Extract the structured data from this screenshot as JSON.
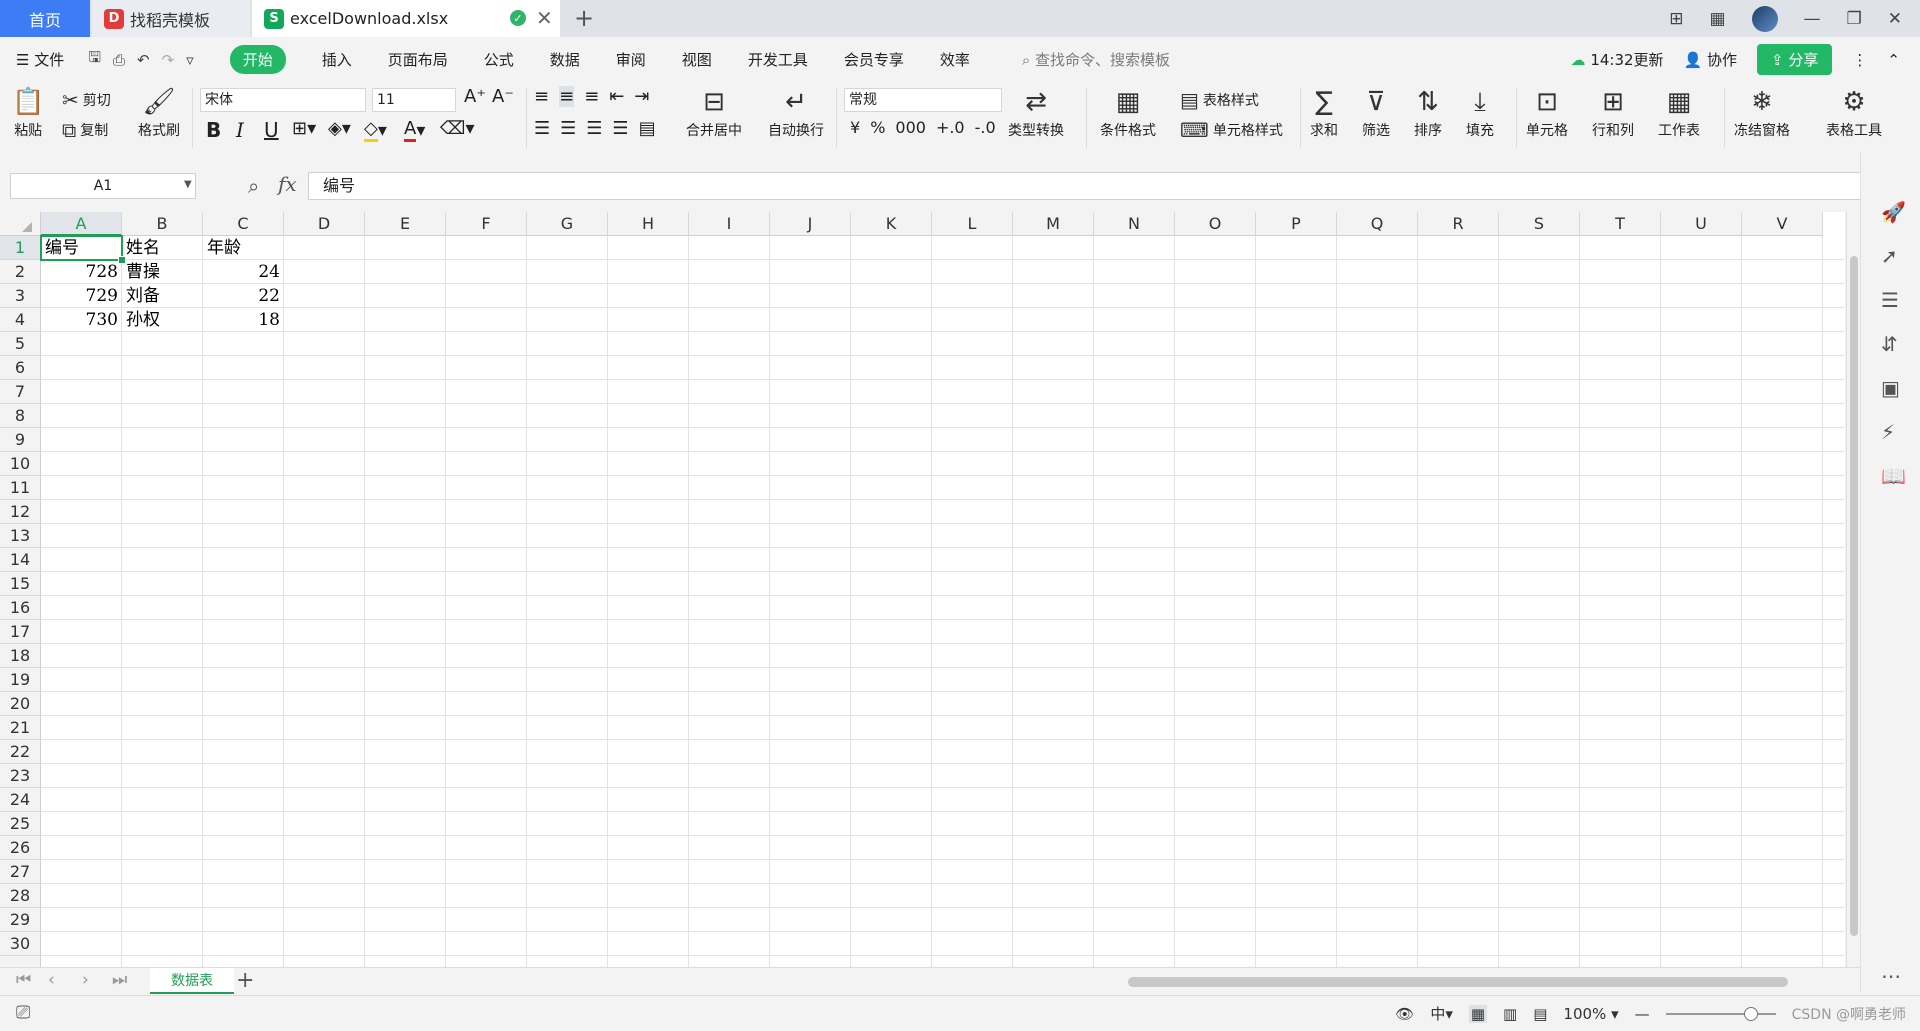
{
  "tabs": {
    "home": "首页",
    "template": "找稻壳模板",
    "file": "excelDownload.xlsx",
    "template_icon_glyph": "D",
    "file_icon_glyph": "S",
    "saved_glyph": "✓",
    "close_glyph": "✕",
    "add_glyph": "+"
  },
  "window_controls": {
    "layout": "⊞",
    "apps": "▦",
    "minimize": "—",
    "restore": "❐",
    "close": "✕"
  },
  "menu": {
    "file": "☰ 文件",
    "items": [
      "开始",
      "插入",
      "页面布局",
      "公式",
      "数据",
      "审阅",
      "视图",
      "开发工具",
      "会员专享",
      "效率"
    ],
    "active_index": 0,
    "search_placeholder": "查找命令、搜索模板",
    "updated": "14:32更新",
    "collaborate": "协作",
    "share": "分享",
    "more": "⋮",
    "collapse": "⌃"
  },
  "ribbon": {
    "paste": "粘贴",
    "cut": "剪切",
    "copy": "复制",
    "format_painter": "格式刷",
    "font_name": "宋体",
    "font_size": "11",
    "bold": "B",
    "italic": "I",
    "underline": "U",
    "merge_center": "合并居中",
    "wrap_text": "自动换行",
    "number_format": "常规",
    "type_convert": "类型转换",
    "conditional_format": "条件格式",
    "table_style": "表格样式",
    "cell_style": "单元格样式",
    "sum": "求和",
    "filter": "筛选",
    "sort": "排序",
    "fill": "填充",
    "cells": "单元格",
    "rows_cols": "行和列",
    "worksheet": "工作表",
    "freeze_panes": "冻结窗格",
    "table_tools": "表格工具",
    "currency": "¥",
    "percent": "%",
    "thousands": "000",
    "inc_decimal": "+.0",
    "dec_decimal": "-.0"
  },
  "formula_bar": {
    "name_box": "A1",
    "fx": "fx",
    "value": "编号"
  },
  "sheet": {
    "columns": [
      "A",
      "B",
      "C",
      "D",
      "E",
      "F",
      "G",
      "H",
      "I",
      "J",
      "K",
      "L",
      "M",
      "N",
      "O",
      "P",
      "Q",
      "R",
      "S",
      "T",
      "U",
      "V"
    ],
    "selected_cell": "A1",
    "row_count_visible": 30,
    "cells": {
      "A1": "编号",
      "B1": "姓名",
      "C1": "年龄",
      "A2": "728",
      "B2": "曹操",
      "C2": "24",
      "A3": "729",
      "B3": "刘备",
      "C3": "22",
      "A4": "730",
      "B4": "孙权",
      "C4": "18"
    }
  },
  "sheet_tabs": {
    "active": "数据表",
    "add": "+"
  },
  "status": {
    "zoom": "100%",
    "watermark": "CSDN @啊勇老师",
    "minus": "—",
    "plus": "+"
  }
}
